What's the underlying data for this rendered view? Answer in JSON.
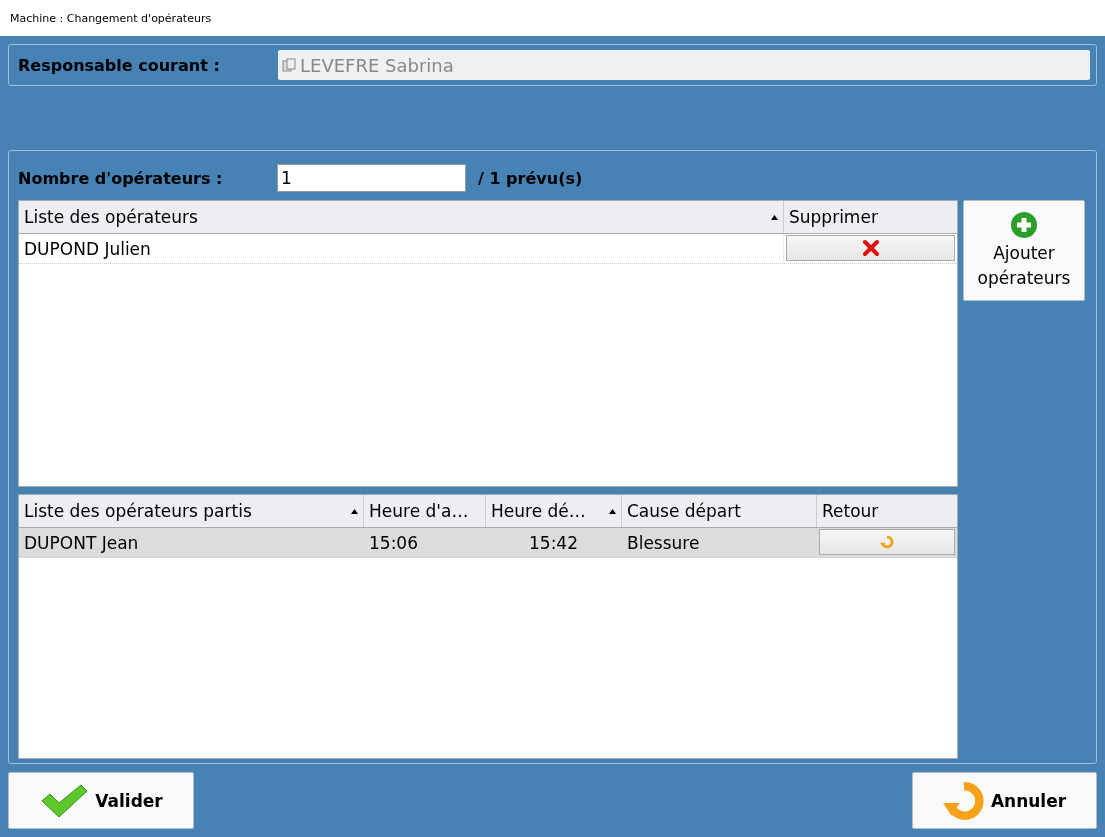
{
  "window": {
    "title": "Machine : Changement d'opérateurs"
  },
  "manager": {
    "label": "Responsable courant :",
    "value": "LEVEFRE Sabrina"
  },
  "operator_count": {
    "label": "Nombre d'opérateurs :",
    "value": "1",
    "planned": "/ 1 prévu(s)"
  },
  "operators_table": {
    "columns": [
      {
        "label": "Liste des opérateurs",
        "sorted": true
      },
      {
        "label": "Supprimer",
        "sorted": false
      }
    ],
    "rows": [
      {
        "name": "DUPOND Julien",
        "selected": false
      }
    ]
  },
  "add_button": {
    "label": "Ajouter opérateurs"
  },
  "departed_table": {
    "columns": [
      {
        "label": "Liste des opérateurs partis",
        "sorted": true
      },
      {
        "label": "Heure d'a…",
        "sorted": false
      },
      {
        "label": "Heure dé…",
        "sorted": true
      },
      {
        "label": "Cause départ",
        "sorted": false
      },
      {
        "label": "Retour",
        "sorted": false
      }
    ],
    "rows": [
      {
        "name": "DUPONT Jean",
        "arrival": "15:06",
        "departure": "15:42",
        "cause": "Blessure",
        "selected": true
      }
    ]
  },
  "buttons": [
    {
      "kind": "validate",
      "label": "Valider"
    },
    {
      "kind": "cancel",
      "label": "Annuler"
    }
  ]
}
